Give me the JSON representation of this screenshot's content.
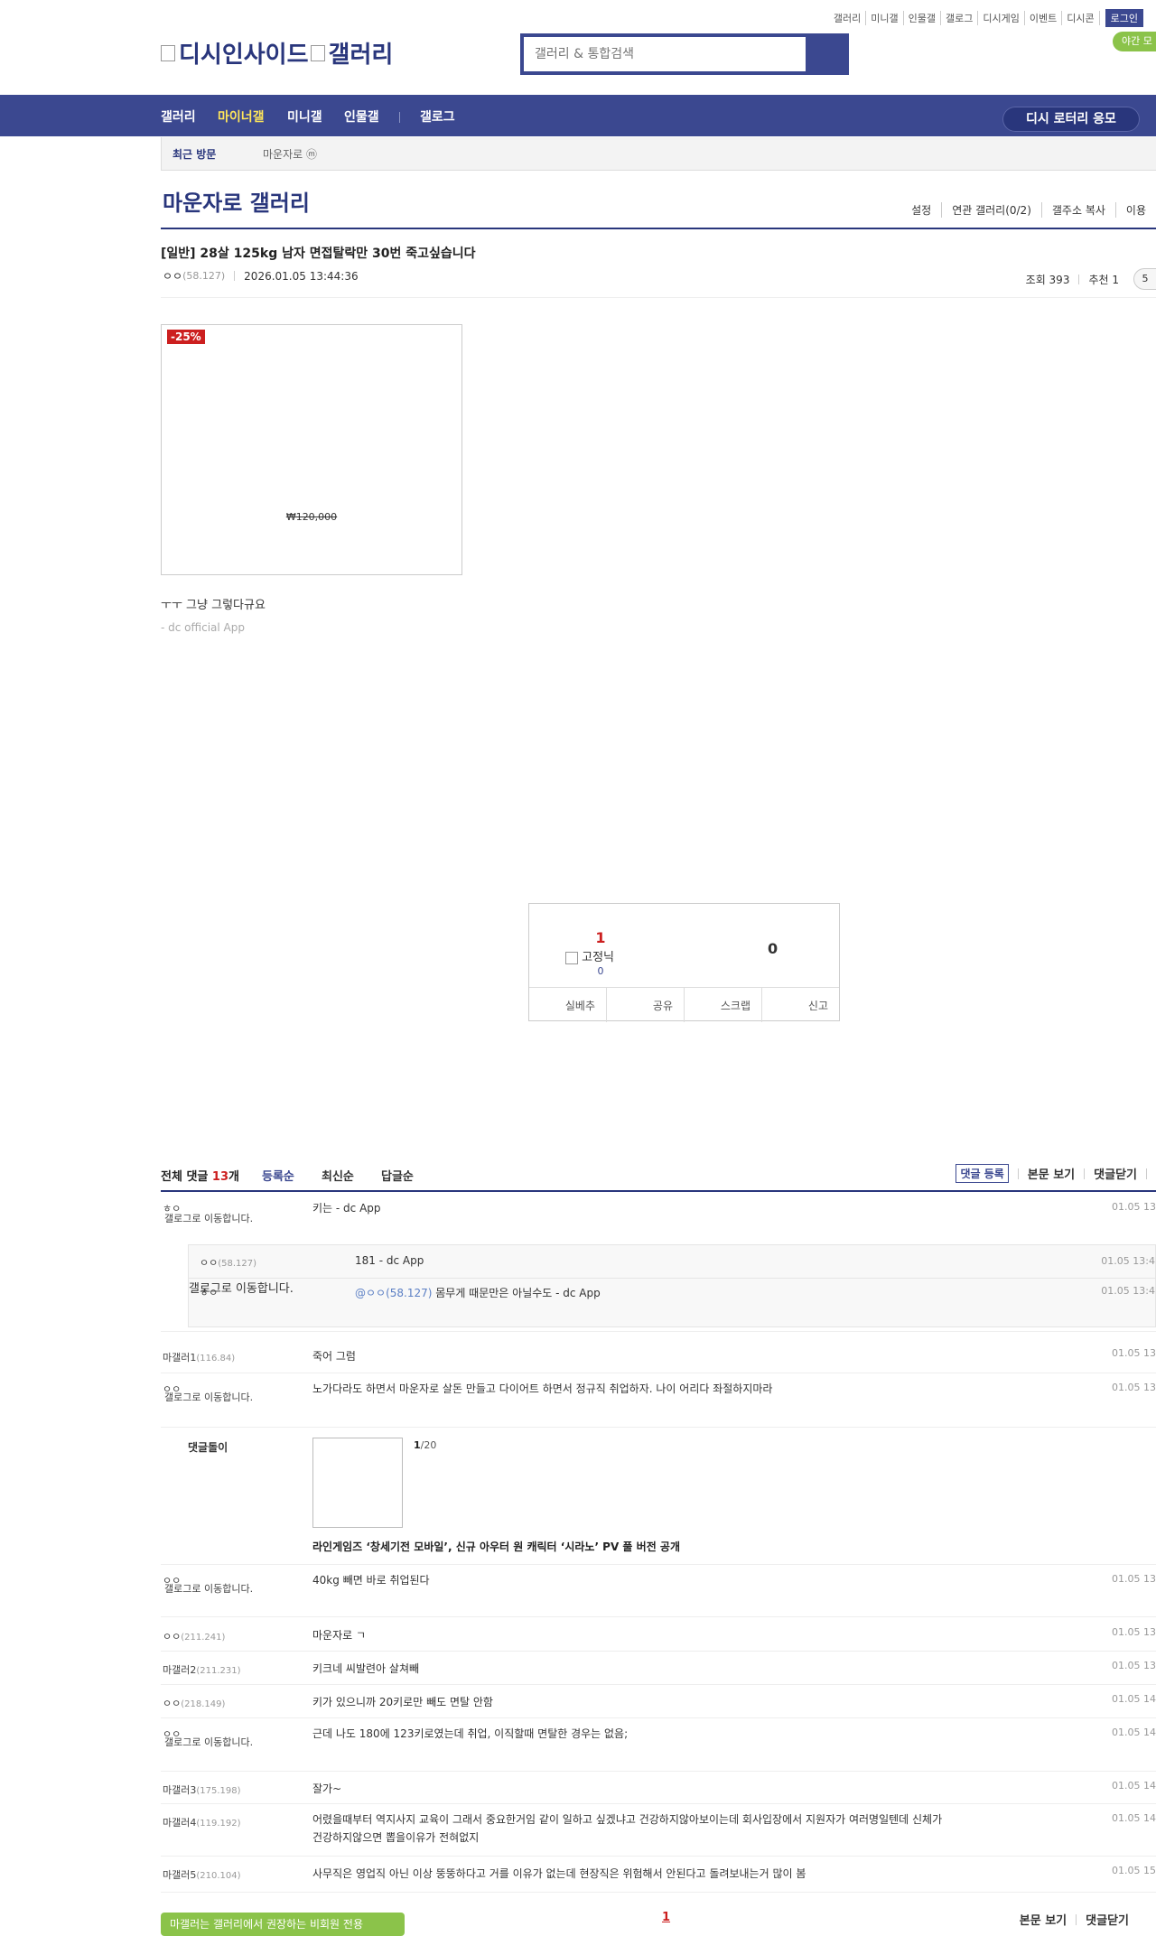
{
  "top": {
    "links": [
      "갤러리",
      "미니갤",
      "인물갤",
      "갤로그",
      "디시게임",
      "이벤트",
      "디시콘"
    ],
    "login": "로그인",
    "night": "야간 모"
  },
  "logo": {
    "a": "디시인사이드",
    "b": "갤러리"
  },
  "search": {
    "placeholder": "갤러리 & 통합검색"
  },
  "nav": {
    "items": [
      "갤러리",
      "마이너갤",
      "미니갤",
      "인물갤",
      "갤로그"
    ],
    "lottery": "디시 로터리 응모"
  },
  "visit": {
    "label": "최근 방문",
    "item": "마운자로 ⓜ"
  },
  "gallery": {
    "title": "마운자로 갤러리",
    "tools": [
      "설정",
      "연관 갤러리(0/2)",
      "갤주소 복사",
      "이용"
    ]
  },
  "post": {
    "title": "[일반] 28살 125kg 남자 면접탈락만 30번 죽고싶습니다",
    "author": "ㅇㅇ",
    "author_ip": "(58.127)",
    "date": "2026.01.05 13:44:36",
    "views": "조회 393",
    "recommend": "추천 1",
    "comment_count_badge": "5",
    "body": "ㅜㅜ 그냥 그렇다규요",
    "signature": "- dc official App"
  },
  "ad": {
    "sale": "-25%",
    "price": "₩120,000"
  },
  "rec": {
    "up": "1",
    "fixed": "고정닉",
    "fixed_count": "0",
    "down": "0",
    "buttons": [
      "실베추",
      "공유",
      "스크랩",
      "신고"
    ]
  },
  "comments_head": {
    "total_prefix": "전체 댓글 ",
    "total_count": "13",
    "total_suffix": "개",
    "sorts": [
      "등록순",
      "최신순",
      "답글순"
    ],
    "register": "댓글 등록",
    "view_body": "본문 보기",
    "close": "댓글닫기"
  },
  "broken_img_text": "갤로그로 이동합니다.",
  "comments": [
    {
      "nick": "ㅎㅇ",
      "ip": "",
      "text": "키는 - dc App",
      "date": "01.05 13"
    },
    {
      "nick": "마갤러1",
      "ip": "(116.84)",
      "text": "죽어 그럼",
      "date": "01.05 13"
    },
    {
      "nick": "ㅇㅇ",
      "ip": "",
      "text": "노가다라도 하면서 마운자로 살돈 만들고 다이어트 하면서 정규직 취업하자. 나이 어리다 좌절하지마라",
      "date": "01.05 13"
    },
    {
      "nick": "ㅇㅇ",
      "ip": "",
      "text": "40kg 빼면 바로 취업된다",
      "date": "01.05 13"
    },
    {
      "nick": "ㅇㅇ",
      "ip": "(211.241)",
      "text": "마운자로 ㄱ",
      "date": "01.05 13"
    },
    {
      "nick": "마갤러2",
      "ip": "(211.231)",
      "text": "키크네 씨발련아 살쳐빼",
      "date": "01.05 13"
    },
    {
      "nick": "ㅇㅇ",
      "ip": "(218.149)",
      "text": "키가 있으니까 20키로만 빼도 면탈 안함",
      "date": "01.05 14"
    },
    {
      "nick": "ㅇㅇ",
      "ip": "",
      "text": "근데 나도 180에 123키로였는데 취업, 이직할때 면탈한 경우는 없음;",
      "date": "01.05 14"
    },
    {
      "nick": "마갤러3",
      "ip": "(175.198)",
      "text": "잘가~",
      "date": "01.05 14"
    },
    {
      "nick": "마갤러4",
      "ip": "(119.192)",
      "text1": "어렸을때부터 역지사지 교육이 그래서 중요한거임 같이 일하고 싶겠냐고 건강하지않아보이는데 회사입장에서 지원자가 여러명일텐데 신체가",
      "text2": "건강하지않으면 뽑을이유가 전혀없지",
      "date": "01.05 14"
    },
    {
      "nick": "마갤러5",
      "ip": "(210.104)",
      "text": "사무직은 영업직 아닌 이상 뚱뚱하다고 거를 이유가 없는데 현장직은 위험해서 안된다고 돌려보내는거 많이 봄",
      "date": "01.05 15"
    }
  ],
  "replies": [
    {
      "nick": "ㅇㅇ",
      "ip": "(58.127)",
      "text": "181 - dc App",
      "date": "01.05 13:4"
    },
    {
      "nick": "ㅎㅇ",
      "to": "@ㅇㅇ(58.127)",
      "text": " 몸무게 때문만은 아닐수도 - dc App",
      "date": "01.05 13:4"
    }
  ],
  "ad_comment": {
    "name": "댓글돌이",
    "page_cur": "1",
    "page_total": "/20",
    "title": "라인게임즈 ‘창세기전 모바일’, 신규 아우터 원 캐릭터 ‘시라노’ PV 풀 버전 공개"
  },
  "bottom": {
    "green": "마갤러는 갤러리에서 권장하는 비회원 전용",
    "page": "1",
    "view_body": "본문 보기",
    "close": "댓글닫기"
  }
}
